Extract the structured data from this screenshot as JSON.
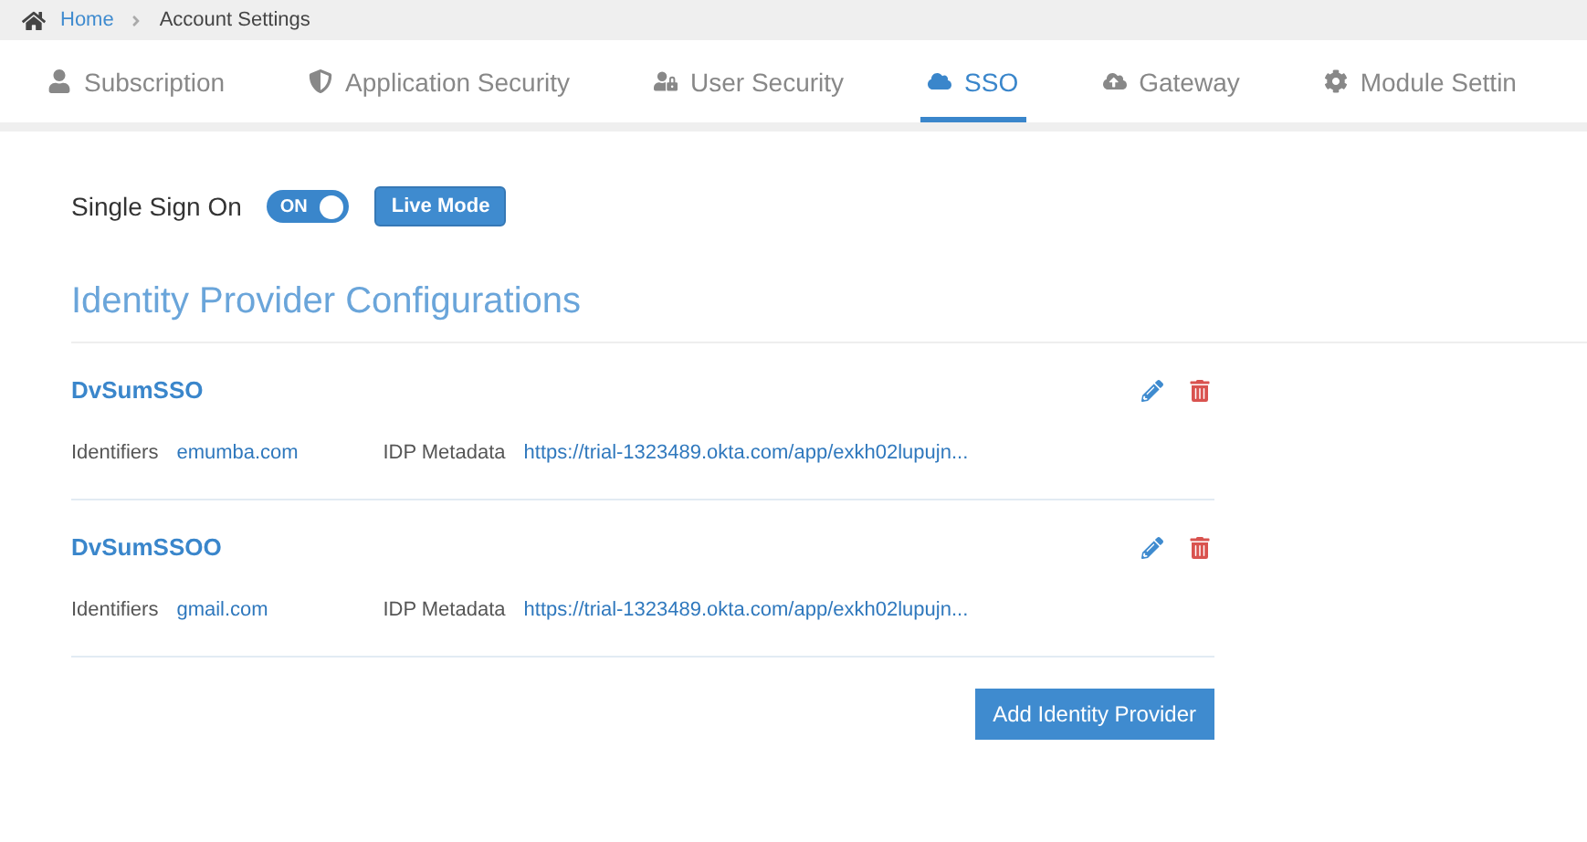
{
  "breadcrumb": [
    {
      "label": "Home",
      "link": true
    },
    {
      "label": "Account Settings",
      "link": false
    }
  ],
  "tabs": [
    {
      "label": "Subscription",
      "selected": false
    },
    {
      "label": "Application Security",
      "selected": false
    },
    {
      "label": "User Security",
      "selected": false
    },
    {
      "label": "SSO",
      "selected": true
    },
    {
      "label": "Gateway",
      "selected": false
    },
    {
      "label": "Module Settin",
      "selected": false
    }
  ],
  "sso": {
    "label": "Single Sign On",
    "toggle": {
      "on": true,
      "text": "ON"
    },
    "mode_button": "Live Mode"
  },
  "section_title": "Identity Provider Configurations",
  "providers": [
    {
      "name": "DvSumSSO",
      "identifiers_label": "Identifiers",
      "identifiers": "emumba.com",
      "metadata_label": "IDP Metadata",
      "metadata": "https://trial-1323489.okta.com/app/exkh02lupujn..."
    },
    {
      "name": "DvSumSSOO",
      "identifiers_label": "Identifiers",
      "identifiers": "gmail.com",
      "metadata_label": "IDP Metadata",
      "metadata": "https://trial-1323489.okta.com/app/exkh02lupujn..."
    }
  ],
  "add_button": "Add Identity Provider"
}
